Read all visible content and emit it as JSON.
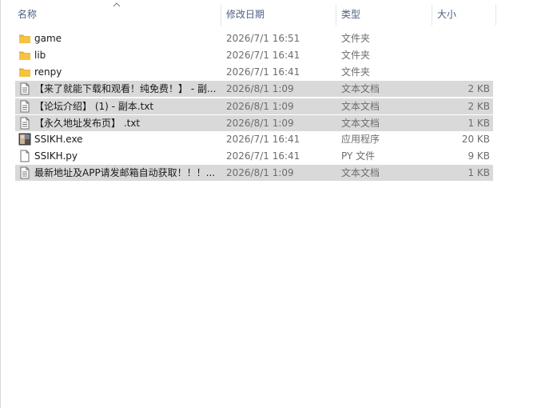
{
  "columns": {
    "name": "名称",
    "date": "修改日期",
    "type": "类型",
    "size": "大小"
  },
  "colors": {
    "header_text": "#4d6082",
    "selected_bg": "#d9d9d9",
    "folder": "#f5c242"
  },
  "files": [
    {
      "name": "game",
      "date": "2026/7/1 16:51",
      "type": "文件夹",
      "size": "",
      "icon": "folder-icon",
      "selected": false
    },
    {
      "name": "lib",
      "date": "2026/7/1 16:41",
      "type": "文件夹",
      "size": "",
      "icon": "folder-icon",
      "selected": false
    },
    {
      "name": "renpy",
      "date": "2026/7/1 16:41",
      "type": "文件夹",
      "size": "",
      "icon": "folder-icon",
      "selected": false
    },
    {
      "name": "【来了就能下载和观看！纯免费！】 - 副...",
      "date": "2026/8/1 1:09",
      "type": "文本文档",
      "size": "2 KB",
      "icon": "text-file-icon",
      "selected": true
    },
    {
      "name": "【论坛介绍】 (1) - 副本.txt",
      "date": "2026/8/1 1:09",
      "type": "文本文档",
      "size": "2 KB",
      "icon": "text-file-icon",
      "selected": true
    },
    {
      "name": "【永久地址发布页】 .txt",
      "date": "2026/8/1 1:09",
      "type": "文本文档",
      "size": "1 KB",
      "icon": "text-file-icon",
      "selected": true
    },
    {
      "name": "SSIKH.exe",
      "date": "2026/7/1 16:41",
      "type": "应用程序",
      "size": "20 KB",
      "icon": "exe-app-icon",
      "selected": false
    },
    {
      "name": "SSIKH.py",
      "date": "2026/7/1 16:41",
      "type": "PY 文件",
      "size": "9 KB",
      "icon": "generic-file-icon",
      "selected": false
    },
    {
      "name": "最新地址及APP请发邮箱自动获取！！！...",
      "date": "2026/8/1 1:09",
      "type": "文本文档",
      "size": "1 KB",
      "icon": "text-file-icon",
      "selected": true
    }
  ]
}
